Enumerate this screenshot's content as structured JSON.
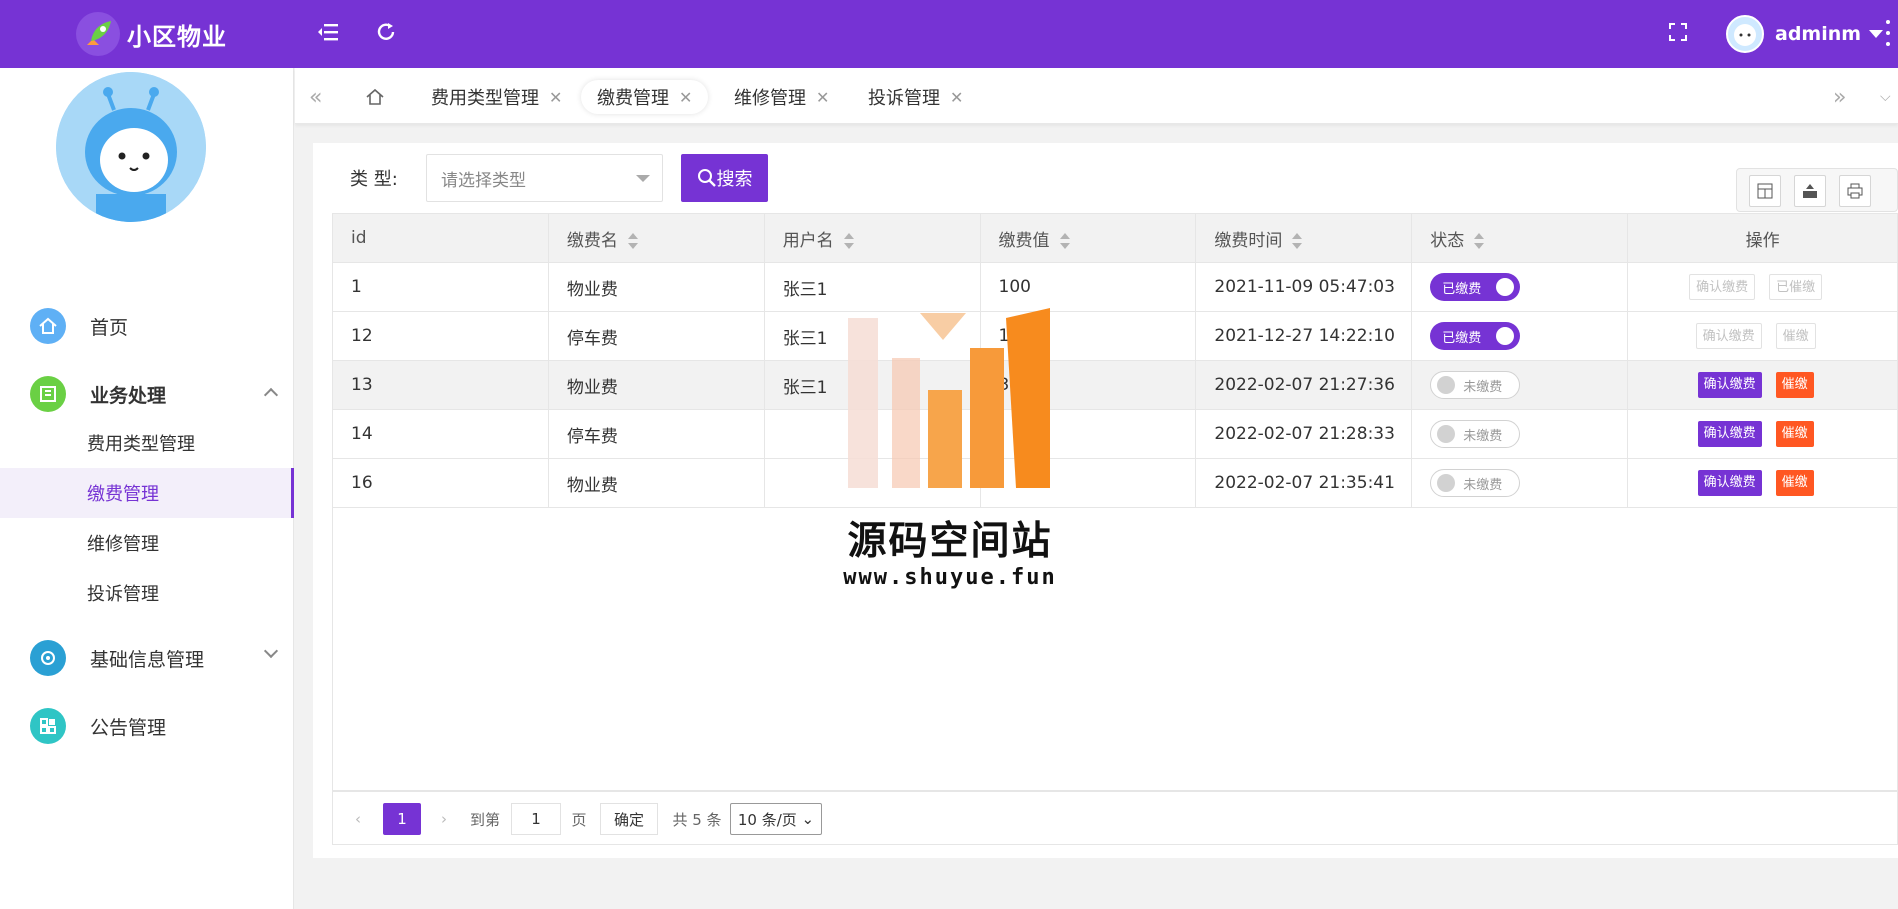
{
  "app": {
    "title": "小区物业"
  },
  "header": {
    "user_name": "adminm",
    "icons": [
      "logo-icon",
      "menu-collapse-icon",
      "refresh-icon",
      "fullscreen-icon",
      "more-icon"
    ]
  },
  "sidebar": {
    "items": [
      {
        "label": "首页",
        "icon": "home-icon",
        "color": "#5fb0f5"
      },
      {
        "label": "业务处理",
        "icon": "business-icon",
        "color": "#6ad044"
      },
      {
        "label": "基础信息管理",
        "icon": "gear-icon",
        "color": "#2aa0d4"
      },
      {
        "label": "公告管理",
        "icon": "apps-icon",
        "color": "#2fc5c5"
      }
    ],
    "sub_items": [
      {
        "label": "费用类型管理"
      },
      {
        "label": "缴费管理"
      },
      {
        "label": "维修管理"
      },
      {
        "label": "投诉管理"
      }
    ]
  },
  "tabs": [
    {
      "label": "费用类型管理"
    },
    {
      "label": "缴费管理"
    },
    {
      "label": "维修管理"
    },
    {
      "label": "投诉管理"
    }
  ],
  "filter": {
    "label": "类 型:",
    "placeholder": "请选择类型",
    "search_label": "搜索"
  },
  "table": {
    "headers": [
      "id",
      "缴费名",
      "用户名",
      "缴费值",
      "缴费时间",
      "状态",
      "操作"
    ],
    "rows": [
      {
        "id": "1",
        "name": "物业费",
        "user": "张三1",
        "value": "100",
        "time": "2021-11-09 05:47:03",
        "status": "已缴费",
        "paid": true,
        "a1": "确认缴费",
        "a2": "已催缴"
      },
      {
        "id": "12",
        "name": "停车费",
        "user": "张三1",
        "value": "100",
        "time": "2021-12-27 14:22:10",
        "status": "已缴费",
        "paid": true,
        "a1": "确认缴费",
        "a2": "催缴"
      },
      {
        "id": "13",
        "name": "物业费",
        "user": "张三1",
        "value": "3",
        "time": "2022-02-07 21:27:36",
        "status": "未缴费",
        "paid": false,
        "a1": "确认缴费",
        "a2": "催缴"
      },
      {
        "id": "14",
        "name": "停车费",
        "user": "",
        "value": "",
        "time": "2022-02-07 21:28:33",
        "status": "未缴费",
        "paid": false,
        "a1": "确认缴费",
        "a2": "催缴"
      },
      {
        "id": "16",
        "name": "物业费",
        "user": "",
        "value": "",
        "time": "2022-02-07 21:35:41",
        "status": "未缴费",
        "paid": false,
        "a1": "确认缴费",
        "a2": "催缴"
      }
    ]
  },
  "pagination": {
    "current": "1",
    "goto_label": "到第",
    "goto_value": "1",
    "page_unit": "页",
    "confirm_label": "确定",
    "total_label": "共 5 条",
    "page_size": "10 条/页"
  },
  "watermark": {
    "title": "源码空间站",
    "url": "www.shuyue.fun"
  },
  "colors": {
    "accent": "#7633d4",
    "danger": "#ff5722"
  }
}
